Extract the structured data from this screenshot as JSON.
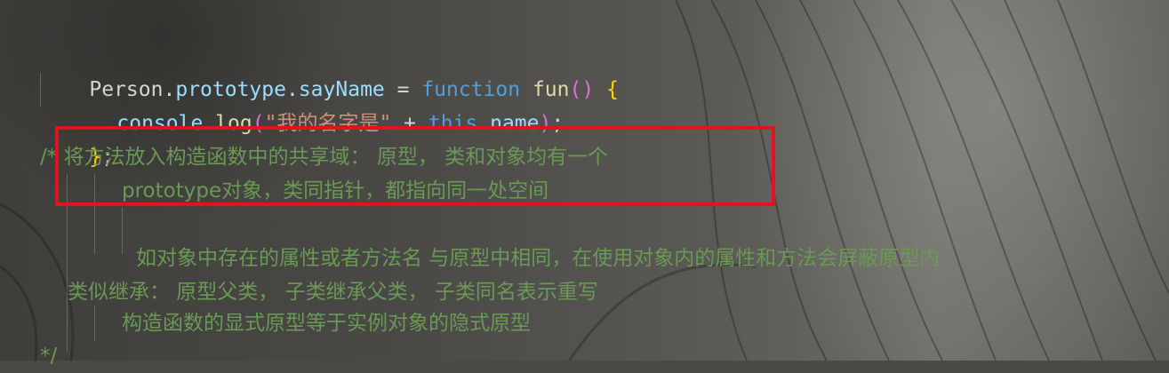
{
  "editor": {
    "lines": {
      "l1": {
        "obj": "Person",
        "dot1": ".",
        "prop1": "prototype",
        "dot2": ".",
        "prop2": "sayName",
        "assign": " = ",
        "kw_function": "function",
        "space": " ",
        "fname": "fun",
        "paren": "()",
        "sp": " ",
        "brace": "{"
      },
      "l2": {
        "console": "console",
        "dot": ".",
        "log": "log",
        "open": "(",
        "str": "\"我的名字是\"",
        "plus": " + ",
        "this": "this",
        "dot2": ".",
        "name": "name",
        "close": ")",
        "semi": ";"
      },
      "l3": {
        "brace": "}",
        "semi": ";"
      },
      "c1": "/* 将方法放入构造函数中的共享域： 原型， 类和对象均有一个",
      "c2": "prototype对象，类同指针，都指向同一处空间",
      "c3": "如对象中存在的属性或者方法名 与原型中相同，在使用对象内的属性和方法会屏蔽原型内",
      "c4": "类似继承： 原型父类， 子类继承父类， 子类同名表示重写",
      "c5": "构造函数的显式原型等于实例对象的隐式原型",
      "c6": "*/"
    }
  },
  "annotation": {
    "color": "#e0141e"
  }
}
